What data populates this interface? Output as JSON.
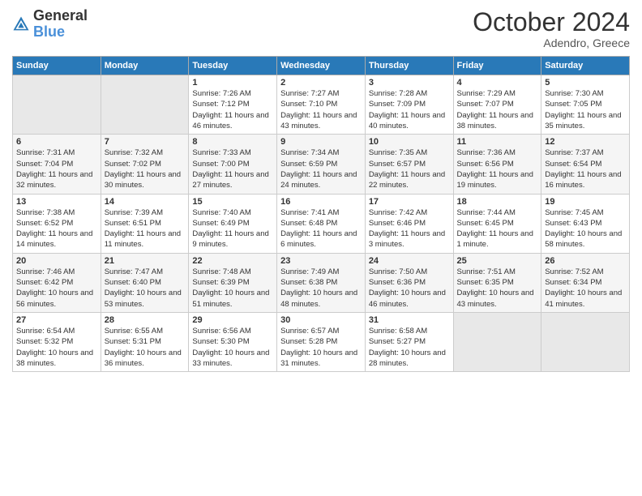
{
  "logo": {
    "general": "General",
    "blue": "Blue"
  },
  "header": {
    "month": "October 2024",
    "location": "Adendro, Greece"
  },
  "days_of_week": [
    "Sunday",
    "Monday",
    "Tuesday",
    "Wednesday",
    "Thursday",
    "Friday",
    "Saturday"
  ],
  "weeks": [
    [
      {
        "day": "",
        "empty": true
      },
      {
        "day": "",
        "empty": true
      },
      {
        "day": "1",
        "sunrise": "Sunrise: 7:26 AM",
        "sunset": "Sunset: 7:12 PM",
        "daylight": "Daylight: 11 hours and 46 minutes."
      },
      {
        "day": "2",
        "sunrise": "Sunrise: 7:27 AM",
        "sunset": "Sunset: 7:10 PM",
        "daylight": "Daylight: 11 hours and 43 minutes."
      },
      {
        "day": "3",
        "sunrise": "Sunrise: 7:28 AM",
        "sunset": "Sunset: 7:09 PM",
        "daylight": "Daylight: 11 hours and 40 minutes."
      },
      {
        "day": "4",
        "sunrise": "Sunrise: 7:29 AM",
        "sunset": "Sunset: 7:07 PM",
        "daylight": "Daylight: 11 hours and 38 minutes."
      },
      {
        "day": "5",
        "sunrise": "Sunrise: 7:30 AM",
        "sunset": "Sunset: 7:05 PM",
        "daylight": "Daylight: 11 hours and 35 minutes."
      }
    ],
    [
      {
        "day": "6",
        "sunrise": "Sunrise: 7:31 AM",
        "sunset": "Sunset: 7:04 PM",
        "daylight": "Daylight: 11 hours and 32 minutes."
      },
      {
        "day": "7",
        "sunrise": "Sunrise: 7:32 AM",
        "sunset": "Sunset: 7:02 PM",
        "daylight": "Daylight: 11 hours and 30 minutes."
      },
      {
        "day": "8",
        "sunrise": "Sunrise: 7:33 AM",
        "sunset": "Sunset: 7:00 PM",
        "daylight": "Daylight: 11 hours and 27 minutes."
      },
      {
        "day": "9",
        "sunrise": "Sunrise: 7:34 AM",
        "sunset": "Sunset: 6:59 PM",
        "daylight": "Daylight: 11 hours and 24 minutes."
      },
      {
        "day": "10",
        "sunrise": "Sunrise: 7:35 AM",
        "sunset": "Sunset: 6:57 PM",
        "daylight": "Daylight: 11 hours and 22 minutes."
      },
      {
        "day": "11",
        "sunrise": "Sunrise: 7:36 AM",
        "sunset": "Sunset: 6:56 PM",
        "daylight": "Daylight: 11 hours and 19 minutes."
      },
      {
        "day": "12",
        "sunrise": "Sunrise: 7:37 AM",
        "sunset": "Sunset: 6:54 PM",
        "daylight": "Daylight: 11 hours and 16 minutes."
      }
    ],
    [
      {
        "day": "13",
        "sunrise": "Sunrise: 7:38 AM",
        "sunset": "Sunset: 6:52 PM",
        "daylight": "Daylight: 11 hours and 14 minutes."
      },
      {
        "day": "14",
        "sunrise": "Sunrise: 7:39 AM",
        "sunset": "Sunset: 6:51 PM",
        "daylight": "Daylight: 11 hours and 11 minutes."
      },
      {
        "day": "15",
        "sunrise": "Sunrise: 7:40 AM",
        "sunset": "Sunset: 6:49 PM",
        "daylight": "Daylight: 11 hours and 9 minutes."
      },
      {
        "day": "16",
        "sunrise": "Sunrise: 7:41 AM",
        "sunset": "Sunset: 6:48 PM",
        "daylight": "Daylight: 11 hours and 6 minutes."
      },
      {
        "day": "17",
        "sunrise": "Sunrise: 7:42 AM",
        "sunset": "Sunset: 6:46 PM",
        "daylight": "Daylight: 11 hours and 3 minutes."
      },
      {
        "day": "18",
        "sunrise": "Sunrise: 7:44 AM",
        "sunset": "Sunset: 6:45 PM",
        "daylight": "Daylight: 11 hours and 1 minute."
      },
      {
        "day": "19",
        "sunrise": "Sunrise: 7:45 AM",
        "sunset": "Sunset: 6:43 PM",
        "daylight": "Daylight: 10 hours and 58 minutes."
      }
    ],
    [
      {
        "day": "20",
        "sunrise": "Sunrise: 7:46 AM",
        "sunset": "Sunset: 6:42 PM",
        "daylight": "Daylight: 10 hours and 56 minutes."
      },
      {
        "day": "21",
        "sunrise": "Sunrise: 7:47 AM",
        "sunset": "Sunset: 6:40 PM",
        "daylight": "Daylight: 10 hours and 53 minutes."
      },
      {
        "day": "22",
        "sunrise": "Sunrise: 7:48 AM",
        "sunset": "Sunset: 6:39 PM",
        "daylight": "Daylight: 10 hours and 51 minutes."
      },
      {
        "day": "23",
        "sunrise": "Sunrise: 7:49 AM",
        "sunset": "Sunset: 6:38 PM",
        "daylight": "Daylight: 10 hours and 48 minutes."
      },
      {
        "day": "24",
        "sunrise": "Sunrise: 7:50 AM",
        "sunset": "Sunset: 6:36 PM",
        "daylight": "Daylight: 10 hours and 46 minutes."
      },
      {
        "day": "25",
        "sunrise": "Sunrise: 7:51 AM",
        "sunset": "Sunset: 6:35 PM",
        "daylight": "Daylight: 10 hours and 43 minutes."
      },
      {
        "day": "26",
        "sunrise": "Sunrise: 7:52 AM",
        "sunset": "Sunset: 6:34 PM",
        "daylight": "Daylight: 10 hours and 41 minutes."
      }
    ],
    [
      {
        "day": "27",
        "sunrise": "Sunrise: 6:54 AM",
        "sunset": "Sunset: 5:32 PM",
        "daylight": "Daylight: 10 hours and 38 minutes."
      },
      {
        "day": "28",
        "sunrise": "Sunrise: 6:55 AM",
        "sunset": "Sunset: 5:31 PM",
        "daylight": "Daylight: 10 hours and 36 minutes."
      },
      {
        "day": "29",
        "sunrise": "Sunrise: 6:56 AM",
        "sunset": "Sunset: 5:30 PM",
        "daylight": "Daylight: 10 hours and 33 minutes."
      },
      {
        "day": "30",
        "sunrise": "Sunrise: 6:57 AM",
        "sunset": "Sunset: 5:28 PM",
        "daylight": "Daylight: 10 hours and 31 minutes."
      },
      {
        "day": "31",
        "sunrise": "Sunrise: 6:58 AM",
        "sunset": "Sunset: 5:27 PM",
        "daylight": "Daylight: 10 hours and 28 minutes."
      },
      {
        "day": "",
        "empty": true
      },
      {
        "day": "",
        "empty": true
      }
    ]
  ]
}
